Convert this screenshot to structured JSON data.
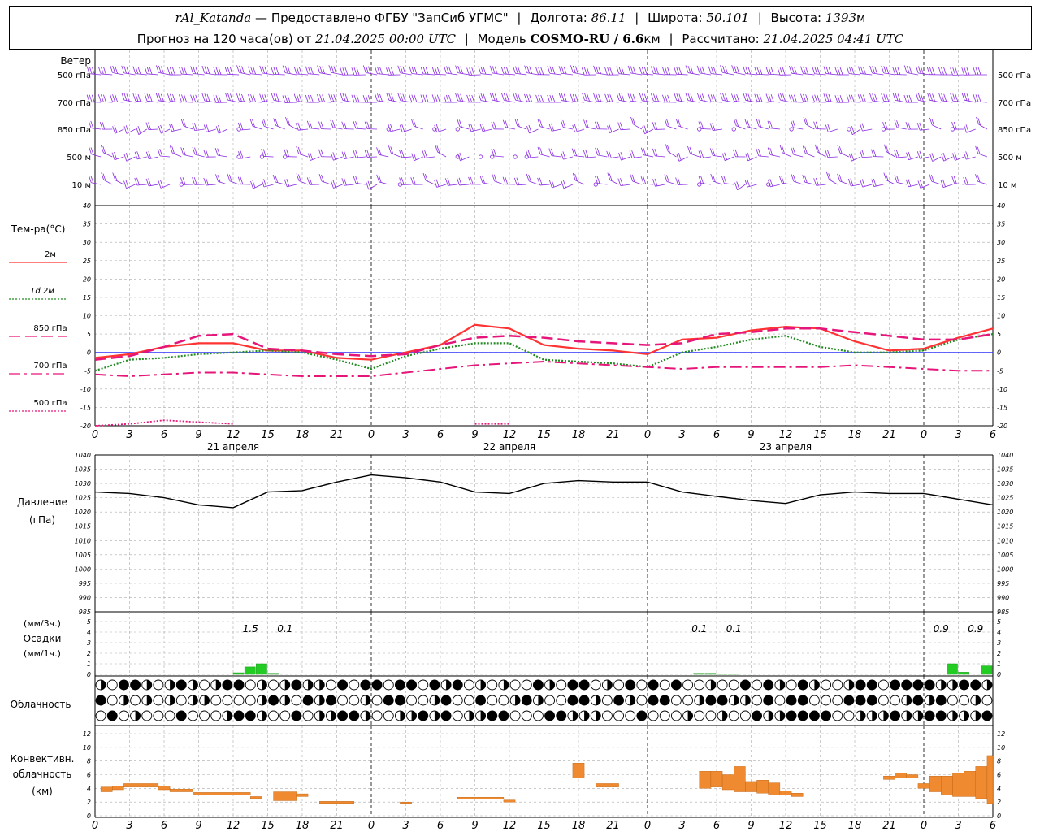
{
  "header": {
    "station": "rAl_Katanda",
    "dash": "—",
    "provider": "Предоставлено ФГБУ \"ЗапСиб УГМС\"",
    "lon_label": "Долгота:",
    "lon_value": "86.11",
    "lat_label": "Широта:",
    "lat_value": "50.101",
    "alt_label": "Высота:",
    "alt_value": "1393",
    "alt_unit": "м",
    "forecast_label": "Прогноз на 120 часа(ов) от",
    "forecast_time": "21.04.2025 00:00 UTC",
    "model_label": "Модель",
    "model_name": "COSMO-RU / 6.6",
    "model_unit": "км",
    "calc_label": "Рассчитано:",
    "calc_time": "21.04.2025 04:41 UTC"
  },
  "wind_panel": {
    "title": "Ветер",
    "levels": [
      "500 гПа",
      "700 гПа",
      "850 гПа",
      "500 м",
      "10 м"
    ]
  },
  "temp_panel": {
    "title": "Тем-ра(°C)",
    "legend": [
      {
        "label": "2м",
        "color": "#ff3333",
        "style": "solid"
      },
      {
        "label": "Td 2м",
        "color": "#228b22",
        "style": "dotted"
      },
      {
        "label": "850 гПа",
        "color": "#e6157a",
        "style": "dashed"
      },
      {
        "label": "700 гПа",
        "color": "#e6157a",
        "style": "dashdot"
      },
      {
        "label": "500 гПа",
        "color": "#e6157a",
        "style": "dotted"
      }
    ],
    "ticks": [
      "40",
      "35",
      "30",
      "25",
      "20",
      "15",
      "10",
      "5",
      "0",
      "-5",
      "-10",
      "-15",
      "-20"
    ]
  },
  "time_axis": {
    "hours": [
      "0",
      "3",
      "6",
      "9",
      "12",
      "15",
      "18",
      "21",
      "0",
      "3",
      "6",
      "9",
      "12",
      "15",
      "18",
      "21",
      "0",
      "3",
      "6",
      "9",
      "12",
      "15",
      "18",
      "21",
      "0",
      "3",
      "6"
    ],
    "dates": [
      "21 апреля",
      "22 апреля",
      "23 апреля"
    ]
  },
  "pressure_panel": {
    "title": "Давление",
    "unit": "(гПа)",
    "ticks": [
      "1040",
      "1035",
      "1030",
      "1025",
      "1020",
      "1015",
      "1010",
      "1005",
      "1000",
      "995",
      "990",
      "985"
    ]
  },
  "precip_panel": {
    "unit3h": "(мм/3ч.)",
    "title": "Осадки",
    "unit1h": "(мм/1ч.)",
    "ticks": [
      "5",
      "4",
      "3",
      "2",
      "1",
      "0"
    ],
    "totals": [
      {
        "text": "1.5",
        "hour": 13.5
      },
      {
        "text": "0.1",
        "hour": 16.5
      },
      {
        "text": "0.1",
        "hour": 52.5
      },
      {
        "text": "0.1",
        "hour": 55.5
      },
      {
        "text": "0.9",
        "hour": 73.5
      },
      {
        "text": "0.9",
        "hour": 76.5
      }
    ]
  },
  "cloud_panel": {
    "title": "Облачность"
  },
  "conv_panel": {
    "title_line1": "Конвективн.",
    "title_line2": "облачность",
    "unit": "(км)",
    "ticks": [
      "12",
      "10",
      "8",
      "6",
      "4",
      "2",
      "0"
    ]
  },
  "colors": {
    "wind": "#8a2be2",
    "t2m": "#ff3333",
    "td": "#228b22",
    "t850": "#e6157a",
    "precip": "#22cc22",
    "conv": "#f08a30",
    "zero": "#3333ff"
  },
  "chart_data": [
    {
      "type": "line",
      "title": "Тем-ра(°C)",
      "x_unit": "hours since 21.04.2025 00:00 UTC",
      "ylim": [
        -20,
        40
      ],
      "series": [
        {
          "name": "2м",
          "x": [
            0,
            3,
            6,
            9,
            12,
            15,
            18,
            21,
            24,
            27,
            30,
            33,
            36,
            39,
            42,
            45,
            48,
            51,
            54,
            57,
            60,
            63,
            66,
            69,
            72,
            75,
            78
          ],
          "values": [
            -1.5,
            -0.5,
            1.5,
            2.5,
            2.5,
            0.5,
            0.5,
            -1.5,
            -2,
            0,
            2,
            7.5,
            6.5,
            2,
            1,
            0.5,
            -0.5,
            3.5,
            4,
            6,
            7,
            6.5,
            3,
            0.5,
            1,
            4,
            6.5
          ]
        },
        {
          "name": "Td 2м",
          "x": [
            0,
            3,
            6,
            9,
            12,
            15,
            18,
            21,
            24,
            27,
            30,
            33,
            36,
            39,
            42,
            45,
            48,
            51,
            54,
            57,
            60,
            63,
            66,
            69,
            72,
            75,
            78
          ],
          "values": [
            -5,
            -2,
            -1.5,
            -0.5,
            0,
            0.5,
            0,
            -2,
            -4.5,
            -1,
            1,
            2.5,
            2.5,
            -2,
            -2.5,
            -3,
            -4,
            0,
            1.5,
            3.5,
            4.5,
            1.5,
            0,
            0,
            0.5,
            3.5,
            5
          ]
        },
        {
          "name": "850 гПа",
          "x": [
            0,
            3,
            6,
            9,
            12,
            15,
            18,
            21,
            24,
            27,
            30,
            33,
            36,
            39,
            42,
            45,
            48,
            51,
            54,
            57,
            60,
            63,
            66,
            69,
            72,
            75,
            78
          ],
          "values": [
            -2,
            -1,
            1.5,
            4.5,
            5,
            1,
            0.5,
            -0.5,
            -1,
            -0.5,
            2,
            4,
            4.5,
            4,
            3,
            2.5,
            2,
            2.5,
            5,
            5.5,
            6.5,
            6.5,
            5.5,
            4.5,
            3.5,
            3.5,
            5
          ]
        },
        {
          "name": "700 гПа",
          "x": [
            0,
            3,
            6,
            9,
            12,
            15,
            18,
            21,
            24,
            27,
            30,
            33,
            36,
            39,
            42,
            45,
            48,
            51,
            54,
            57,
            60,
            63,
            66,
            69,
            72,
            75,
            78
          ],
          "values": [
            -6,
            -6.5,
            -6,
            -5.5,
            -5.5,
            -6,
            -6.5,
            -6.5,
            -6.5,
            -5.5,
            -4.5,
            -3.5,
            -3,
            -2.5,
            -3,
            -3.5,
            -4,
            -4.5,
            -4,
            -4,
            -4,
            -4,
            -3.5,
            -4,
            -4.5,
            -5,
            -5
          ]
        },
        {
          "name": "500 гПа",
          "x": [
            0,
            3,
            6,
            9,
            12,
            15,
            18,
            21,
            24,
            27,
            30,
            33,
            36,
            39,
            42,
            45,
            48,
            51,
            54,
            57,
            60,
            63,
            66,
            69,
            72,
            75,
            78
          ],
          "values": [
            -20,
            -19.5,
            -18.5,
            -19,
            -19.5,
            null,
            null,
            null,
            null,
            null,
            null,
            -19.5,
            -19.5,
            null,
            null,
            null,
            null,
            null,
            null,
            null,
            null,
            null,
            null,
            null,
            null,
            null,
            null
          ]
        }
      ]
    },
    {
      "type": "line",
      "title": "Давление",
      "ylabel": "(гПа)",
      "ylim": [
        985,
        1040
      ],
      "series": [
        {
          "name": "Давление",
          "x": [
            0,
            3,
            6,
            9,
            12,
            15,
            18,
            21,
            24,
            27,
            30,
            33,
            36,
            39,
            42,
            45,
            48,
            51,
            54,
            57,
            60,
            63,
            66,
            69,
            72,
            75,
            78
          ],
          "values": [
            1027,
            1026.5,
            1025,
            1022.5,
            1021.5,
            1027,
            1027.5,
            1030.5,
            1033,
            1032,
            1030.5,
            1027,
            1026.5,
            1030,
            1031,
            1030.5,
            1030.5,
            1027,
            1025.5,
            1024,
            1023,
            1026,
            1027,
            1026.5,
            1026.5,
            1024.5,
            1022.5
          ]
        }
      ]
    },
    {
      "type": "bar",
      "title": "Осадки",
      "ylabel": "(мм/1ч.)",
      "ylim": [
        0,
        5
      ],
      "x": [
        12,
        13,
        14,
        15,
        52,
        53,
        54,
        55,
        74,
        75,
        77
      ],
      "values": [
        0.15,
        0.7,
        1,
        0.1,
        0.1,
        0.1,
        0.05,
        0.05,
        1,
        0.2,
        0.8
      ]
    },
    {
      "type": "bar",
      "title": "Конвективн. облачность",
      "ylabel": "(км)",
      "ylim": [
        0,
        12
      ],
      "bars": [
        {
          "x0": 0.5,
          "x1": 1.5,
          "low": 3.5,
          "high": 4.2
        },
        {
          "x0": 1.5,
          "x1": 2.5,
          "low": 3.8,
          "high": 4.3
        },
        {
          "x0": 2.5,
          "x1": 5.5,
          "low": 4.2,
          "high": 4.7
        },
        {
          "x0": 5.5,
          "x1": 6.5,
          "low": 3.8,
          "high": 4.3
        },
        {
          "x0": 6.5,
          "x1": 8.5,
          "low": 3.5,
          "high": 3.9
        },
        {
          "x0": 8.5,
          "x1": 13.5,
          "low": 3.0,
          "high": 3.4
        },
        {
          "x0": 13.5,
          "x1": 14.5,
          "low": 2.5,
          "high": 2.8
        },
        {
          "x0": 15.5,
          "x1": 17.5,
          "low": 2.2,
          "high": 3.5
        },
        {
          "x0": 17.5,
          "x1": 18.5,
          "low": 2.8,
          "high": 3.2
        },
        {
          "x0": 19.5,
          "x1": 22.5,
          "low": 1.8,
          "high": 2.1
        },
        {
          "x0": 26.5,
          "x1": 27.5,
          "low": 1.8,
          "high": 2.0
        },
        {
          "x0": 31.5,
          "x1": 35.5,
          "low": 2.4,
          "high": 2.7
        },
        {
          "x0": 35.5,
          "x1": 36.5,
          "low": 2.0,
          "high": 2.3
        },
        {
          "x0": 41.5,
          "x1": 42.5,
          "low": 5.5,
          "high": 7.7
        },
        {
          "x0": 43.5,
          "x1": 45.5,
          "low": 4.2,
          "high": 4.7
        },
        {
          "x0": 52.5,
          "x1": 53.5,
          "low": 4.0,
          "high": 6.5
        },
        {
          "x0": 53.5,
          "x1": 54.5,
          "low": 4.2,
          "high": 6.5
        },
        {
          "x0": 54.5,
          "x1": 55.5,
          "low": 3.8,
          "high": 6.0
        },
        {
          "x0": 55.5,
          "x1": 56.5,
          "low": 3.5,
          "high": 7.2
        },
        {
          "x0": 56.5,
          "x1": 57.5,
          "low": 3.5,
          "high": 5.0
        },
        {
          "x0": 57.5,
          "x1": 58.5,
          "low": 3.3,
          "high": 5.2
        },
        {
          "x0": 58.5,
          "x1": 59.5,
          "low": 3.0,
          "high": 4.8
        },
        {
          "x0": 59.5,
          "x1": 60.5,
          "low": 3.0,
          "high": 3.6
        },
        {
          "x0": 60.5,
          "x1": 61.5,
          "low": 2.8,
          "high": 3.3
        },
        {
          "x0": 68.5,
          "x1": 69.5,
          "low": 5.3,
          "high": 5.8
        },
        {
          "x0": 69.5,
          "x1": 70.5,
          "low": 5.5,
          "high": 6.2
        },
        {
          "x0": 70.5,
          "x1": 71.5,
          "low": 5.5,
          "high": 6.0
        },
        {
          "x0": 71.5,
          "x1": 72.5,
          "low": 4.0,
          "high": 4.7
        },
        {
          "x0": 72.5,
          "x1": 73.5,
          "low": 3.5,
          "high": 5.8
        },
        {
          "x0": 73.5,
          "x1": 74.5,
          "low": 3.0,
          "high": 5.8
        },
        {
          "x0": 74.5,
          "x1": 75.5,
          "low": 2.8,
          "high": 6.2
        },
        {
          "x0": 75.5,
          "x1": 76.5,
          "low": 2.8,
          "high": 6.5
        },
        {
          "x0": 76.5,
          "x1": 77.5,
          "low": 2.5,
          "high": 7.2
        },
        {
          "x0": 77.5,
          "x1": 78,
          "low": 1.8,
          "high": 8.8
        }
      ]
    }
  ]
}
